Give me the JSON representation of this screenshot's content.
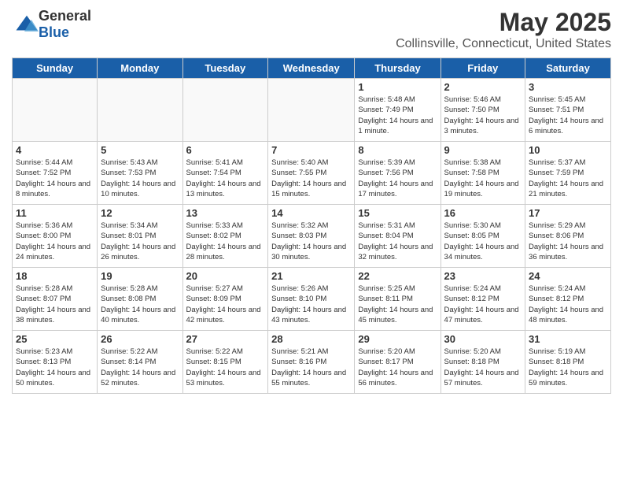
{
  "logo": {
    "general": "General",
    "blue": "Blue"
  },
  "title": "May 2025",
  "subtitle": "Collinsville, Connecticut, United States",
  "days_of_week": [
    "Sunday",
    "Monday",
    "Tuesday",
    "Wednesday",
    "Thursday",
    "Friday",
    "Saturday"
  ],
  "weeks": [
    [
      {
        "day": "",
        "info": ""
      },
      {
        "day": "",
        "info": ""
      },
      {
        "day": "",
        "info": ""
      },
      {
        "day": "",
        "info": ""
      },
      {
        "day": "1",
        "info": "Sunrise: 5:48 AM\nSunset: 7:49 PM\nDaylight: 14 hours and 1 minute."
      },
      {
        "day": "2",
        "info": "Sunrise: 5:46 AM\nSunset: 7:50 PM\nDaylight: 14 hours and 3 minutes."
      },
      {
        "day": "3",
        "info": "Sunrise: 5:45 AM\nSunset: 7:51 PM\nDaylight: 14 hours and 6 minutes."
      }
    ],
    [
      {
        "day": "4",
        "info": "Sunrise: 5:44 AM\nSunset: 7:52 PM\nDaylight: 14 hours and 8 minutes."
      },
      {
        "day": "5",
        "info": "Sunrise: 5:43 AM\nSunset: 7:53 PM\nDaylight: 14 hours and 10 minutes."
      },
      {
        "day": "6",
        "info": "Sunrise: 5:41 AM\nSunset: 7:54 PM\nDaylight: 14 hours and 13 minutes."
      },
      {
        "day": "7",
        "info": "Sunrise: 5:40 AM\nSunset: 7:55 PM\nDaylight: 14 hours and 15 minutes."
      },
      {
        "day": "8",
        "info": "Sunrise: 5:39 AM\nSunset: 7:56 PM\nDaylight: 14 hours and 17 minutes."
      },
      {
        "day": "9",
        "info": "Sunrise: 5:38 AM\nSunset: 7:58 PM\nDaylight: 14 hours and 19 minutes."
      },
      {
        "day": "10",
        "info": "Sunrise: 5:37 AM\nSunset: 7:59 PM\nDaylight: 14 hours and 21 minutes."
      }
    ],
    [
      {
        "day": "11",
        "info": "Sunrise: 5:36 AM\nSunset: 8:00 PM\nDaylight: 14 hours and 24 minutes."
      },
      {
        "day": "12",
        "info": "Sunrise: 5:34 AM\nSunset: 8:01 PM\nDaylight: 14 hours and 26 minutes."
      },
      {
        "day": "13",
        "info": "Sunrise: 5:33 AM\nSunset: 8:02 PM\nDaylight: 14 hours and 28 minutes."
      },
      {
        "day": "14",
        "info": "Sunrise: 5:32 AM\nSunset: 8:03 PM\nDaylight: 14 hours and 30 minutes."
      },
      {
        "day": "15",
        "info": "Sunrise: 5:31 AM\nSunset: 8:04 PM\nDaylight: 14 hours and 32 minutes."
      },
      {
        "day": "16",
        "info": "Sunrise: 5:30 AM\nSunset: 8:05 PM\nDaylight: 14 hours and 34 minutes."
      },
      {
        "day": "17",
        "info": "Sunrise: 5:29 AM\nSunset: 8:06 PM\nDaylight: 14 hours and 36 minutes."
      }
    ],
    [
      {
        "day": "18",
        "info": "Sunrise: 5:28 AM\nSunset: 8:07 PM\nDaylight: 14 hours and 38 minutes."
      },
      {
        "day": "19",
        "info": "Sunrise: 5:28 AM\nSunset: 8:08 PM\nDaylight: 14 hours and 40 minutes."
      },
      {
        "day": "20",
        "info": "Sunrise: 5:27 AM\nSunset: 8:09 PM\nDaylight: 14 hours and 42 minutes."
      },
      {
        "day": "21",
        "info": "Sunrise: 5:26 AM\nSunset: 8:10 PM\nDaylight: 14 hours and 43 minutes."
      },
      {
        "day": "22",
        "info": "Sunrise: 5:25 AM\nSunset: 8:11 PM\nDaylight: 14 hours and 45 minutes."
      },
      {
        "day": "23",
        "info": "Sunrise: 5:24 AM\nSunset: 8:12 PM\nDaylight: 14 hours and 47 minutes."
      },
      {
        "day": "24",
        "info": "Sunrise: 5:24 AM\nSunset: 8:12 PM\nDaylight: 14 hours and 48 minutes."
      }
    ],
    [
      {
        "day": "25",
        "info": "Sunrise: 5:23 AM\nSunset: 8:13 PM\nDaylight: 14 hours and 50 minutes."
      },
      {
        "day": "26",
        "info": "Sunrise: 5:22 AM\nSunset: 8:14 PM\nDaylight: 14 hours and 52 minutes."
      },
      {
        "day": "27",
        "info": "Sunrise: 5:22 AM\nSunset: 8:15 PM\nDaylight: 14 hours and 53 minutes."
      },
      {
        "day": "28",
        "info": "Sunrise: 5:21 AM\nSunset: 8:16 PM\nDaylight: 14 hours and 55 minutes."
      },
      {
        "day": "29",
        "info": "Sunrise: 5:20 AM\nSunset: 8:17 PM\nDaylight: 14 hours and 56 minutes."
      },
      {
        "day": "30",
        "info": "Sunrise: 5:20 AM\nSunset: 8:18 PM\nDaylight: 14 hours and 57 minutes."
      },
      {
        "day": "31",
        "info": "Sunrise: 5:19 AM\nSunset: 8:18 PM\nDaylight: 14 hours and 59 minutes."
      }
    ]
  ]
}
